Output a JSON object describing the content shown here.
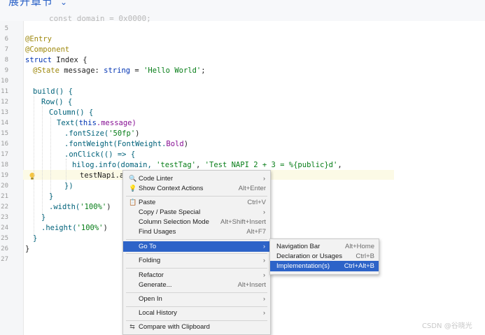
{
  "header": {
    "chapter_toggle": "展开章节",
    "chevron_glyph": "⌄",
    "ghost_text": "const domain = 0x0000;"
  },
  "editor": {
    "line_numbers": [
      "5",
      "6",
      "7",
      "8",
      "9",
      "10",
      "11",
      "12",
      "13",
      "14",
      "15",
      "16",
      "17",
      "18",
      "19",
      "20",
      "21",
      "22",
      "23",
      "24",
      "25",
      "26",
      "27"
    ],
    "code": {
      "l6": "@Entry",
      "l7": "@Component",
      "l8_kw": "struct",
      "l8_name": " Index {",
      "l9_an": "@State",
      "l9_a": " message: ",
      "l9_ty": "string",
      "l9_b": " = ",
      "l9_str": "'Hello World'",
      "l9_c": ";",
      "l11": "build() {",
      "l12": "Row() {",
      "l13": "Column() {",
      "l14_fn": "Text(",
      "l14_kw": "this",
      "l14_b": ".message)",
      "l15_a": ".fontSize(",
      "l15_str": "'50fp'",
      "l15_b": ")",
      "l16_a": ".fontWeight(FontWeight.",
      "l16_b": "Bold",
      "l16_c": ")",
      "l17": ".onClick(() => {",
      "l18_a": "hilog.info(domain, ",
      "l18_s1": "'testTag'",
      "l18_b": ", ",
      "l18_s2": "'Test NAPI 2 + 3 = %{public}d'",
      "l18_c": ",",
      "l19": "testNapi.ad",
      "l20": "})",
      "l21": "}",
      "l22_a": ".width(",
      "l22_str": "'100%'",
      "l22_b": ")",
      "l23": "}",
      "l24_a": ".height(",
      "l24_str": "'100%'",
      "l24_b": ")",
      "l25": "}",
      "l26": "}"
    }
  },
  "context_menu": {
    "items": [
      {
        "icon": "code-linter-icon",
        "glyph": "🔍",
        "label": "Code Linter",
        "shortcut": "",
        "submenu": true
      },
      {
        "icon": "bulb-icon",
        "glyph": "💡",
        "label": "Show Context Actions",
        "shortcut": "Alt+Enter",
        "submenu": false
      },
      {
        "icon": "paste-icon",
        "glyph": "📋",
        "label": "Paste",
        "shortcut": "Ctrl+V",
        "submenu": false
      },
      {
        "icon": "",
        "glyph": "",
        "label": "Copy / Paste Special",
        "shortcut": "",
        "submenu": true
      },
      {
        "icon": "",
        "glyph": "",
        "label": "Column Selection Mode",
        "shortcut": "Alt+Shift+Insert",
        "submenu": false
      },
      {
        "icon": "",
        "glyph": "",
        "label": "Find Usages",
        "shortcut": "Alt+F7",
        "submenu": false
      },
      {
        "icon": "",
        "glyph": "",
        "label": "Go To",
        "shortcut": "",
        "submenu": true
      },
      {
        "icon": "",
        "glyph": "",
        "label": "Folding",
        "shortcut": "",
        "submenu": true
      },
      {
        "icon": "",
        "glyph": "",
        "label": "Refactor",
        "shortcut": "",
        "submenu": true
      },
      {
        "icon": "",
        "glyph": "",
        "label": "Generate...",
        "shortcut": "Alt+Insert",
        "submenu": false
      },
      {
        "icon": "",
        "glyph": "",
        "label": "Open In",
        "shortcut": "",
        "submenu": true
      },
      {
        "icon": "",
        "glyph": "",
        "label": "Local History",
        "shortcut": "",
        "submenu": true
      },
      {
        "icon": "compare-icon",
        "glyph": "⇆",
        "label": "Compare with Clipboard",
        "shortcut": "",
        "submenu": false
      }
    ],
    "arrow_glyph": "›"
  },
  "goto_submenu": {
    "items": [
      {
        "label": "Navigation Bar",
        "shortcut": "Alt+Home"
      },
      {
        "label": "Declaration or Usages",
        "shortcut": "Ctrl+B"
      },
      {
        "label": "Implementation(s)",
        "shortcut": "Ctrl+Alt+B"
      }
    ]
  },
  "watermark": "CSDN @谷晓光"
}
